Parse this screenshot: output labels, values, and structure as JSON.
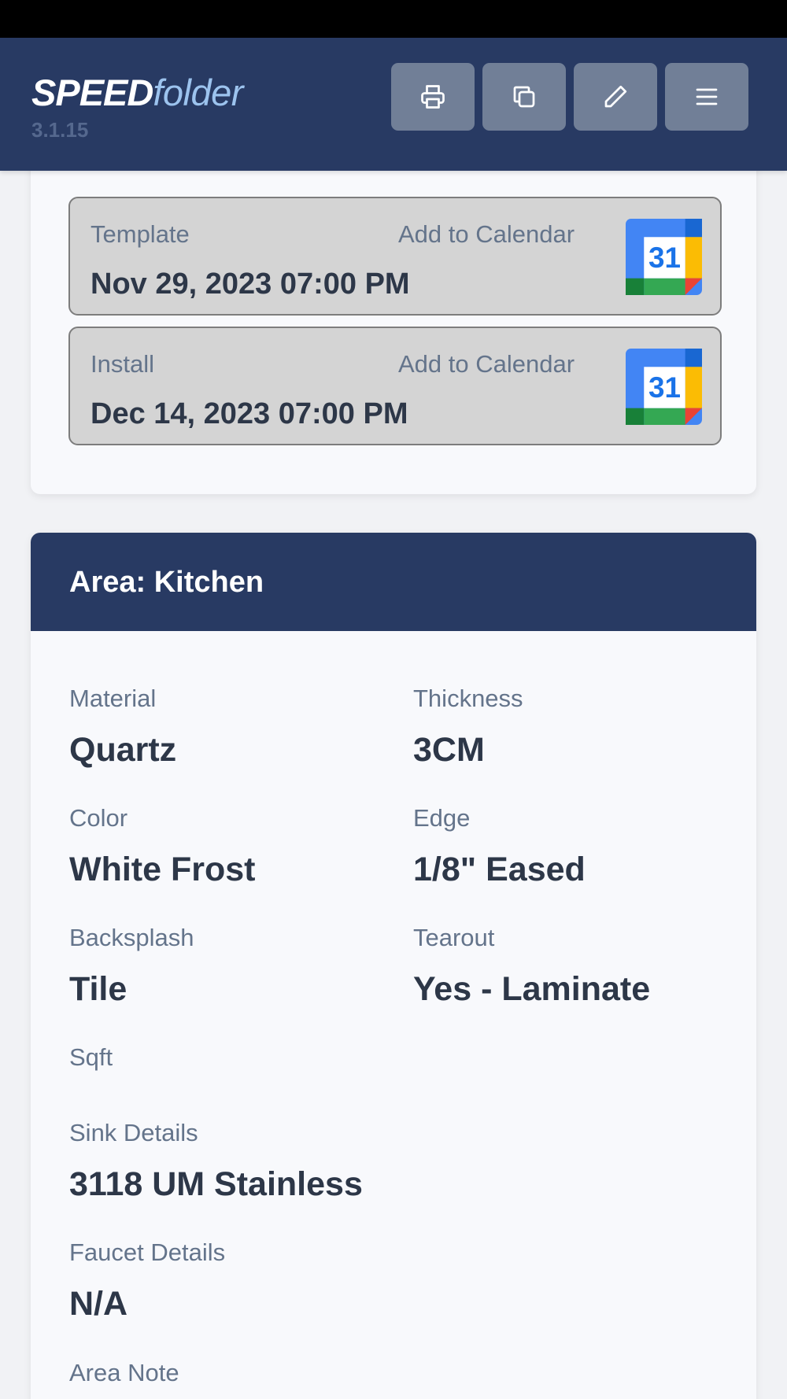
{
  "header": {
    "brand_speed": "SPEED",
    "brand_folder": "folder",
    "version": "3.1.15",
    "buttons": [
      "printer-icon",
      "copy-icon",
      "pencil-icon",
      "menu-icon"
    ]
  },
  "schedule": [
    {
      "label": "Template",
      "add_to_calendar": "Add to Calendar",
      "date": "Nov 29, 2023 07:00 PM",
      "icon_day": "31"
    },
    {
      "label": "Install",
      "add_to_calendar": "Add to Calendar",
      "date": "Dec 14, 2023 07:00 PM",
      "icon_day": "31"
    }
  ],
  "area": {
    "title": "Area: Kitchen",
    "material": {
      "label": "Material",
      "value": "Quartz"
    },
    "thickness": {
      "label": "Thickness",
      "value": "3CM"
    },
    "color": {
      "label": "Color",
      "value": "White Frost"
    },
    "edge": {
      "label": "Edge",
      "value": "1/8\" Eased"
    },
    "backsplash": {
      "label": "Backsplash",
      "value": "Tile"
    },
    "tearout": {
      "label": "Tearout",
      "value": "Yes - Laminate"
    },
    "sqft": {
      "label": "Sqft",
      "value": ""
    },
    "sink": {
      "label": "Sink Details",
      "value": "3118 UM Stainless"
    },
    "faucet": {
      "label": "Faucet Details",
      "value": "N/A"
    },
    "note": {
      "label": "Area Note"
    }
  },
  "colors": {
    "header_bg": "#283a63",
    "button_bg": "#717f97",
    "brand_accent": "#9cc3ee",
    "date_box_bg": "#d4d4d4"
  }
}
